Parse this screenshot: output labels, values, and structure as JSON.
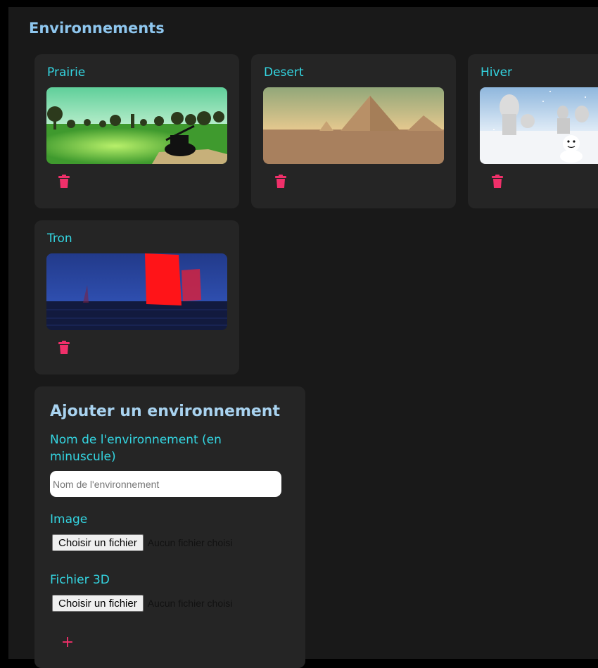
{
  "section": {
    "title": "Environnements"
  },
  "environments": [
    {
      "name": "Prairie",
      "theme": "prairie",
      "delete_icon": "trash-icon"
    },
    {
      "name": "Desert",
      "theme": "desert",
      "delete_icon": "trash-icon"
    },
    {
      "name": "Hiver",
      "theme": "winter",
      "delete_icon": "trash-icon"
    },
    {
      "name": "Tron",
      "theme": "tron",
      "delete_icon": "trash-icon"
    }
  ],
  "form": {
    "title": "Ajouter un environnement",
    "name_label": "Nom de l'environnement (en minuscule)",
    "name_placeholder": "Nom de l'environnement",
    "name_value": "",
    "image_label": "Image",
    "image_button": "Choisir un fichier",
    "image_status": "Aucun fichier choisi",
    "model_label": "Fichier 3D",
    "model_button": "Choisir un fichier",
    "model_status": "Aucun fichier choisi",
    "add_icon": "plus-icon"
  },
  "colors": {
    "accent_title": "#34d6e2",
    "heading": "#8ec6ee",
    "danger": "#f0306a",
    "card_bg": "#252525",
    "page_bg": "#191919"
  }
}
